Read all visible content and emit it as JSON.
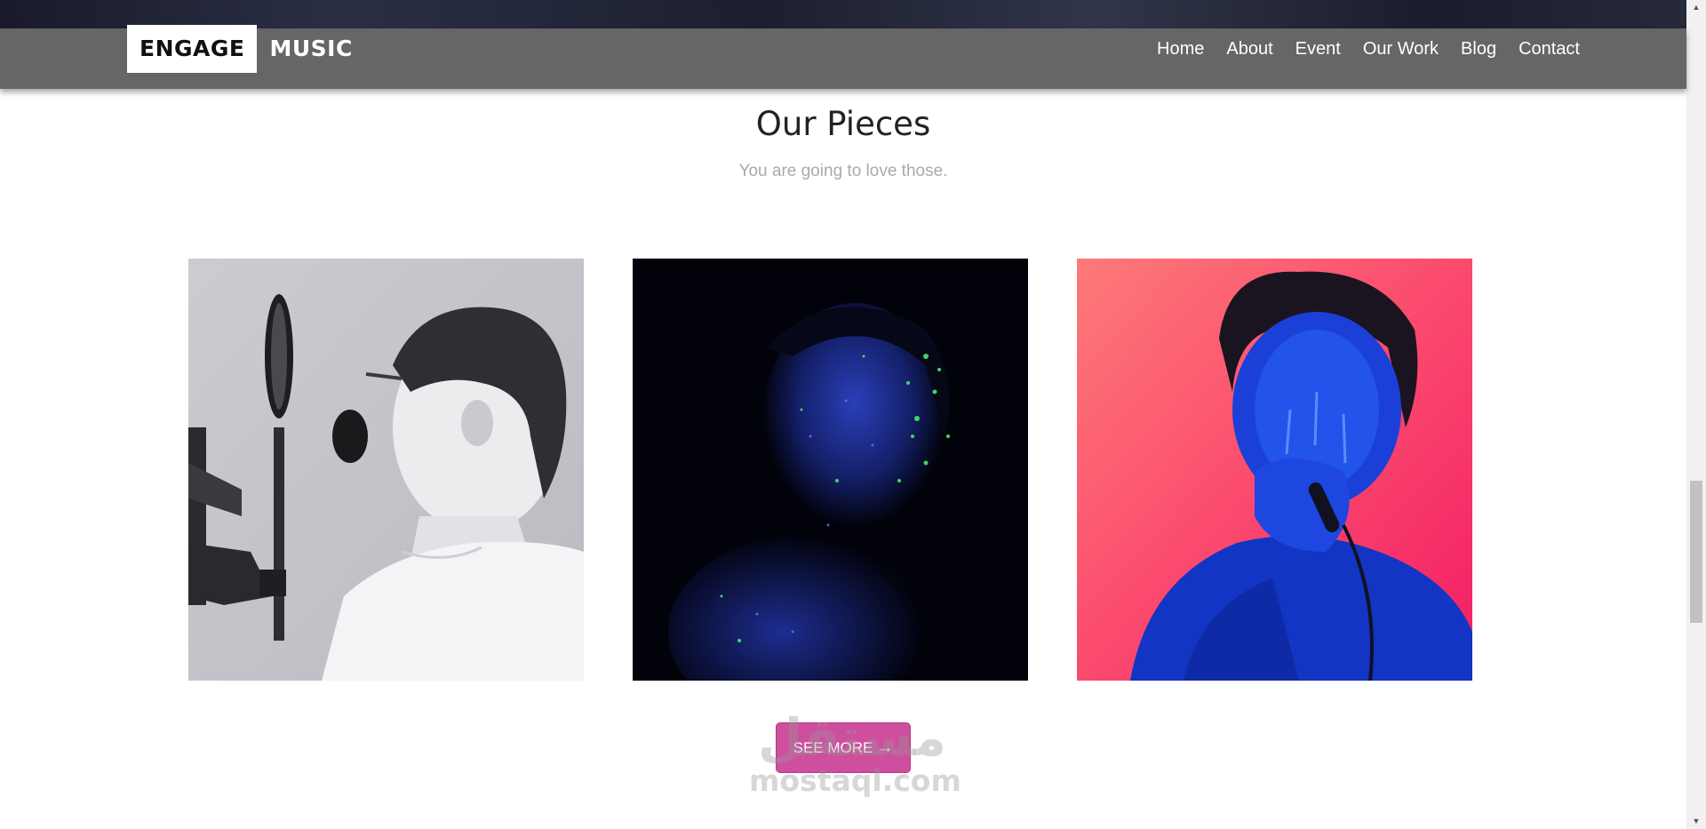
{
  "brand": {
    "boxed": "ENGAGE",
    "rest": "MUSIC"
  },
  "nav": {
    "items": [
      "Home",
      "About",
      "Event",
      "Our Work",
      "Blog",
      "Contact"
    ]
  },
  "section": {
    "title": "Our Pieces",
    "subtitle": "You are going to love those."
  },
  "gallery": {
    "images": [
      {
        "icon": "boy-singing-into-microphone-image"
      },
      {
        "icon": "woman-with-glitter-face-image"
      },
      {
        "icon": "man-singing-blue-paint-image"
      }
    ]
  },
  "button": {
    "label": "SEE MORE",
    "arrow": "→",
    "color": "#cf4f9f"
  },
  "watermark": {
    "logo": "مستقل",
    "url": "mostaql.com"
  },
  "scrollbar": {
    "up": "▲",
    "down": "▼"
  },
  "colors": {
    "navbar": "#666666",
    "title": "#222222",
    "subtitle": "#aaaaaa"
  }
}
